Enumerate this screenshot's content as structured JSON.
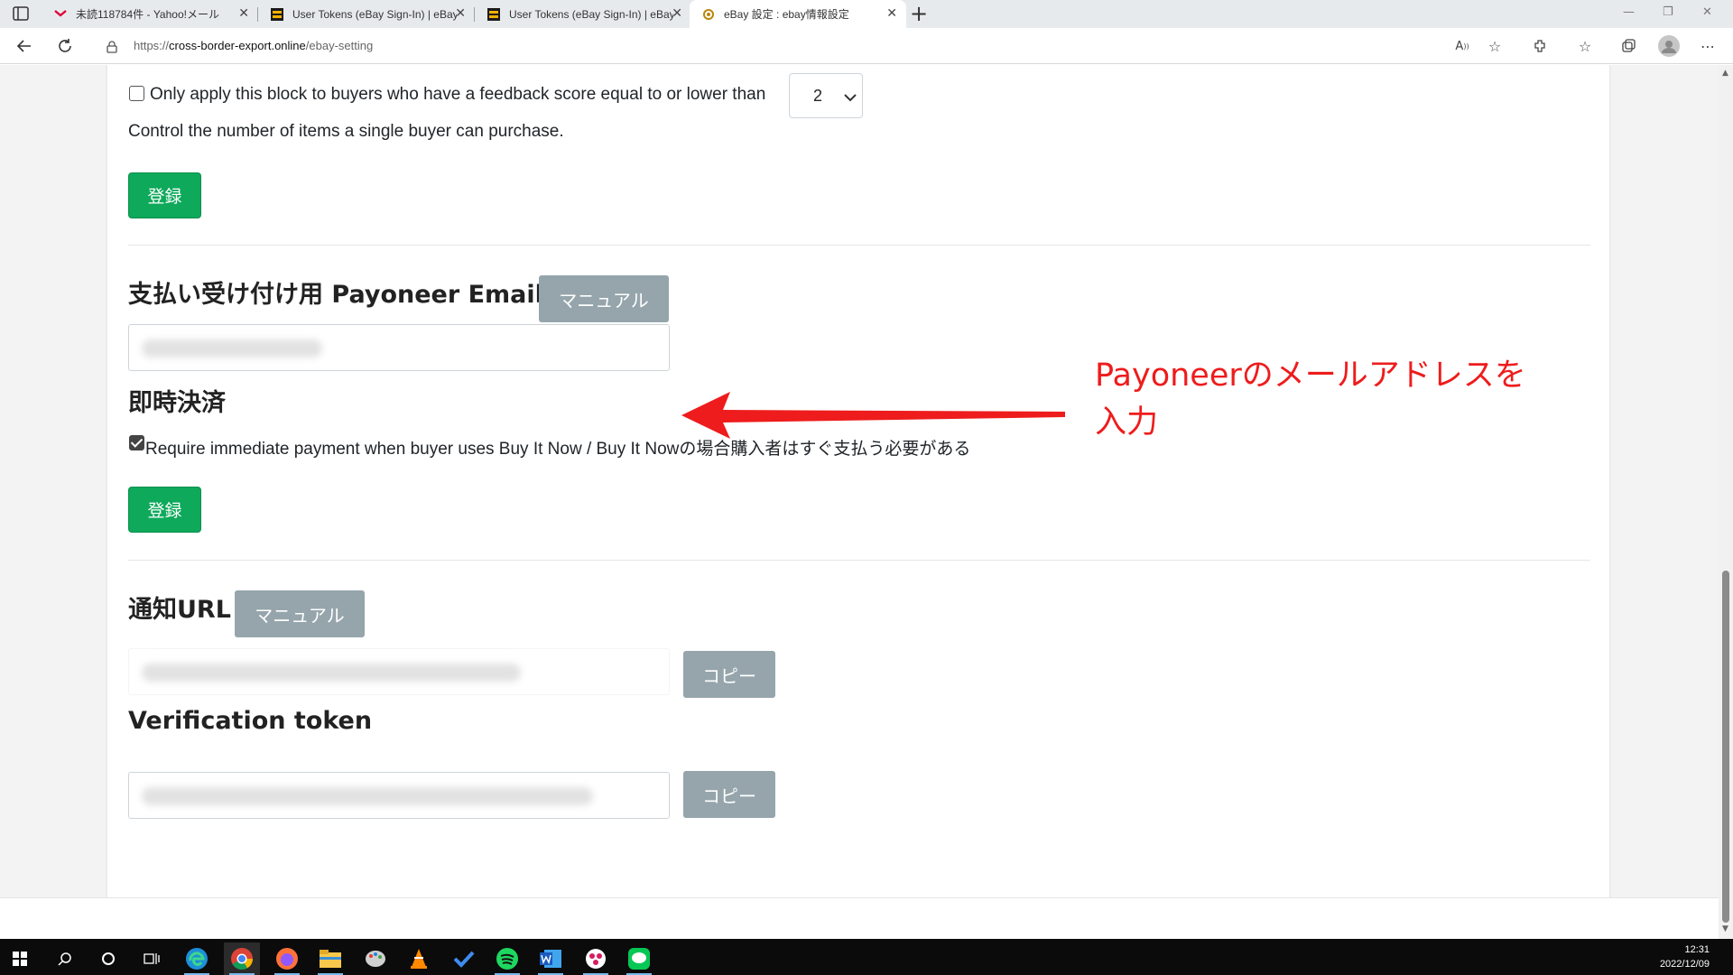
{
  "browser": {
    "tabs": [
      {
        "title": "未読118784件 - Yahoo!メール",
        "icon": "yahoo-mail-icon"
      },
      {
        "title": "User Tokens (eBay Sign-In) | eBay",
        "icon": "ebay-dev-icon"
      },
      {
        "title": "User Tokens (eBay Sign-In) | eBay",
        "icon": "ebay-dev-icon"
      },
      {
        "title": "eBay 設定 : ebay情報設定",
        "icon": "site-favicon"
      }
    ],
    "active_tab": 3,
    "url": {
      "scheme": "https://",
      "host": "cross-border-export.online",
      "path": "/ebay-setting"
    }
  },
  "blocker": {
    "feedback_label": "Only apply this block to buyers who have a feedback score equal to or lower than",
    "feedback_checked": false,
    "feedback_value": "2",
    "purchase_limit_text": "Control the number of items a single buyer can purchase.",
    "submit_label": "登録"
  },
  "payoneer": {
    "heading": "支払い受け付け用 Payoneer Email",
    "manual_label": "マニュアル"
  },
  "immediate_payment": {
    "heading": "即時決済",
    "checkbox_label": "Require immediate payment when buyer uses Buy It Now / Buy It Nowの場合購入者はすぐ支払う必要がある",
    "checked": true,
    "submit_label": "登録"
  },
  "notification": {
    "heading": "通知URL",
    "manual_label": "マニュアル",
    "copy_label": "コピー"
  },
  "verification": {
    "heading": "Verification token",
    "copy_label": "コピー"
  },
  "annotation": {
    "line1": "Payoneerのメールアドレスを",
    "line2": "入力",
    "color": "#ee1c1c"
  },
  "colors": {
    "primary_green": "#0ea95b",
    "manual_grey": "#95a5ab"
  },
  "taskbar": {
    "apps": [
      "windows-start-icon",
      "search-icon",
      "cortana-icon",
      "task-view-icon",
      "edge-icon",
      "chrome-icon",
      "firefox-icon",
      "file-explorer-icon",
      "paint-icon",
      "vlc-icon",
      "todo-icon",
      "spotify-icon",
      "word-icon",
      "app-icon",
      "line-icon"
    ],
    "time": "12:31",
    "date": "2022/12/09"
  }
}
